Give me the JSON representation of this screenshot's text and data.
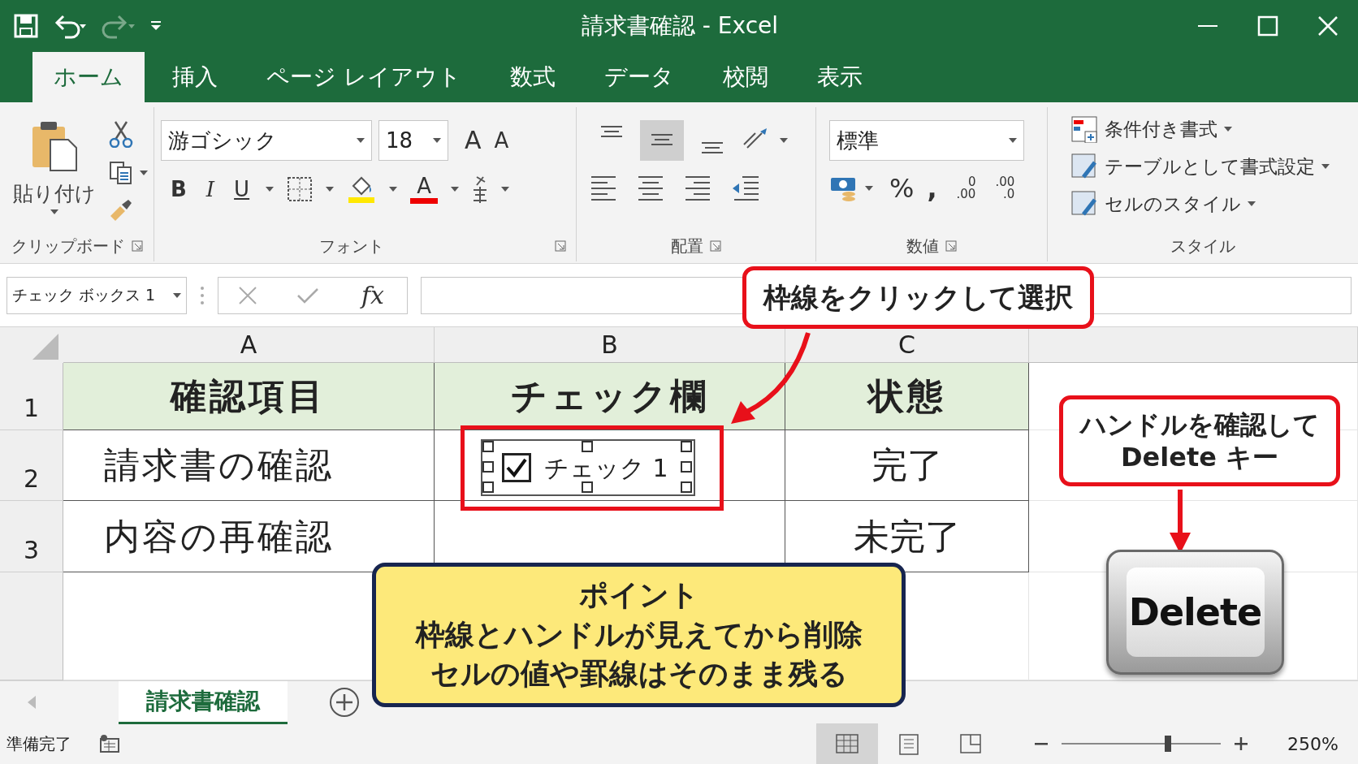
{
  "window": {
    "title": "請求書確認  -  Excel"
  },
  "tabs": [
    {
      "label": "ホーム",
      "selected": true
    },
    {
      "label": "挿入",
      "selected": false
    },
    {
      "label": "ページ レイアウト",
      "selected": false
    },
    {
      "label": "数式",
      "selected": false
    },
    {
      "label": "データ",
      "selected": false
    },
    {
      "label": "校閲",
      "selected": false
    },
    {
      "label": "表示",
      "selected": false
    }
  ],
  "ribbon": {
    "clipboard": {
      "label": "クリップボード",
      "paste": "貼り付け"
    },
    "font": {
      "label": "フォント",
      "font_name": "游ゴシック",
      "font_size": "18",
      "grow": "A",
      "shrink": "A",
      "bold": "B",
      "italic": "I",
      "underline": "U",
      "font_color": "A"
    },
    "alignment": {
      "label": "配置",
      "vertical": [
        {
          "kind": "top",
          "selected": false
        },
        {
          "kind": "middle",
          "selected": true
        },
        {
          "kind": "bottom",
          "selected": false
        }
      ]
    },
    "number": {
      "label": "数値",
      "format": "標準",
      "percent": "%",
      "comma": ",",
      "increase_decimal": [
        "0",
        ".00"
      ],
      "decrease_decimal": [
        ".00",
        ".0"
      ]
    },
    "styles": {
      "label": "スタイル",
      "items": [
        "条件付き書式",
        "テーブルとして書式設定",
        "セルのスタイル"
      ]
    }
  },
  "formula_bar": {
    "name_box": "チェック ボックス 1",
    "fx": "fx"
  },
  "sheet": {
    "columns": [
      "A",
      "B",
      "C"
    ],
    "rows": [
      {
        "number": "1",
        "kind": "header",
        "a": "確認項目",
        "b": "チェック欄",
        "c": "状態"
      },
      {
        "number": "2",
        "kind": "data",
        "a": "請求書の確認",
        "checkbox": {
          "label": "チェック 1",
          "checked": true
        },
        "c": "完了"
      },
      {
        "number": "3",
        "kind": "data",
        "a": "内容の再確認",
        "c": "未完了"
      }
    ]
  },
  "callouts": [
    {
      "kind": "select",
      "lines": [
        "枠線をクリックして選択"
      ]
    },
    {
      "kind": "handle",
      "lines": [
        "ハンドルを確認して",
        "Delete キー"
      ]
    }
  ],
  "point_box": {
    "title": "ポイント",
    "lines": [
      "枠線とハンドルが見えてから削除",
      "セルの値や罫線はそのまま残る"
    ]
  },
  "delete_key": {
    "label": "Delete"
  },
  "sheet_tabs": [
    {
      "label": "請求書確認",
      "selected": true
    }
  ],
  "status_bar": {
    "text": "準備完了",
    "views": [
      {
        "kind": "normal",
        "selected": true
      },
      {
        "kind": "page",
        "selected": false
      },
      {
        "kind": "break",
        "selected": false
      }
    ],
    "zoom_slider": {
      "level": 0.67
    },
    "zoom": "250%"
  }
}
